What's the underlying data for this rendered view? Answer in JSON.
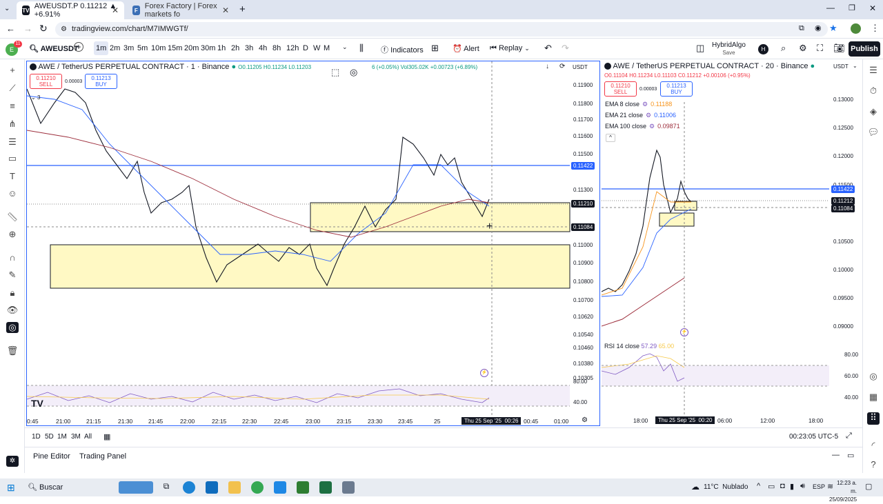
{
  "browser": {
    "tabs": [
      {
        "label": "AWEUSDT.P 0.11212 ▲ +6.91%"
      },
      {
        "label": "Forex Factory | Forex markets fo"
      }
    ],
    "url": "tradingview.com/chart/M7IMWGTf/"
  },
  "toolbar": {
    "avatar_badge": "11",
    "symbol": "AWEUSDT",
    "intervals": [
      "1m",
      "2m",
      "3m",
      "5m",
      "10m",
      "15m",
      "20m",
      "30m",
      "1h",
      "2h",
      "3h",
      "4h",
      "8h",
      "12h",
      "D",
      "W",
      "M"
    ],
    "active_interval": "1m",
    "indicators": "Indicators",
    "alert": "Alert",
    "replay": "Replay",
    "layout_name": "HybridAlgo",
    "layout_sub": "Save",
    "profile_letter": "H",
    "publish": "Publish"
  },
  "left_chart": {
    "title": "AWE / TetherUS PERPETUAL CONTRACT · 1 · Binance",
    "ohlc": "O0.11205 H0.11234 L0.11203",
    "change": "6 (+0.05%) Vol305.02K +0.00723 (+6.89%)",
    "currency": "USDT",
    "sell_price": "0.11210",
    "sell_label": "SELL",
    "spread": "0.00003",
    "buy_price": "0.11213",
    "buy_label": "BUY",
    "legend_count": "3",
    "price_labels": [
      "0.11900",
      "0.11800",
      "0.11700",
      "0.11600",
      "0.11500",
      "0.11300",
      "0.11000",
      "0.10900",
      "0.10800",
      "0.10700",
      "0.10620",
      "0.10540",
      "0.10460",
      "0.10380",
      "0.10305"
    ],
    "tags": [
      {
        "text": "0.11422",
        "color": "#2962ff"
      },
      {
        "text": "0.11210",
        "color": "#131722"
      },
      {
        "text": "0.11084",
        "color": "#131722"
      }
    ],
    "rsi_labels": [
      "80.00",
      "40.00"
    ],
    "time_labels": [
      "0:45",
      "21:00",
      "21:15",
      "21:30",
      "21:45",
      "22:00",
      "22:15",
      "22:30",
      "22:45",
      "23:00",
      "23:15",
      "23:30",
      "23:45",
      "25",
      "00:45",
      "01:00"
    ],
    "cursor_time": "Thu 25 Sep '25  00:26"
  },
  "right_chart": {
    "title": "AWE / TetherUS PERPETUAL CONTRACT · 20 · Binance",
    "ohlc": "O0.11104 H0.11234 L0.11103 C0.11212 +0.00106 (+0.95%)",
    "currency": "USDT",
    "sell_price": "0.11210",
    "sell_label": "SELL",
    "spread": "0.00003",
    "buy_price": "0.11213",
    "buy_label": "BUY",
    "indicators": [
      {
        "name": "EMA 8 close",
        "value": "0.11188",
        "color": "#f7931a"
      },
      {
        "name": "EMA 21 close",
        "value": "0.11006",
        "color": "#2962ff"
      },
      {
        "name": "EMA 100 close",
        "value": "0.09871",
        "color": "#9c2c3a"
      }
    ],
    "price_labels": [
      "0.13000",
      "0.12500",
      "0.12000",
      "0.11500",
      "0.10500",
      "0.10000",
      "0.09500",
      "0.09000"
    ],
    "tags": [
      {
        "text": "0.11422",
        "color": "#2962ff"
      },
      {
        "text": "0.11212",
        "color": "#131722"
      },
      {
        "text": "0.11084",
        "color": "#131722"
      }
    ],
    "rsi_title": "RSI 14 close",
    "rsi_value": "57.29",
    "rsi_ma": "65.00",
    "rsi_labels": [
      "80.00",
      "60.00",
      "40.00"
    ],
    "time_labels": [
      "18:00",
      "06:00",
      "12:00",
      "18:00"
    ],
    "cursor_time": "Thu 25 Sep '25  00:20"
  },
  "bottom": {
    "ranges": [
      "1D",
      "5D",
      "1M",
      "3M",
      "All"
    ],
    "clock": "00:23:05 UTC-5",
    "tabs": [
      "Pine Editor",
      "Trading Panel"
    ]
  },
  "taskbar": {
    "search": "Buscar",
    "weather": "11°C  Nublado",
    "lang": "ESP",
    "time": "12:23 a. m.",
    "date": "25/09/2025"
  },
  "colors": {
    "accent": "#2962ff",
    "zone": "#fff9c4",
    "up": "#089981",
    "down": "#f23645"
  }
}
